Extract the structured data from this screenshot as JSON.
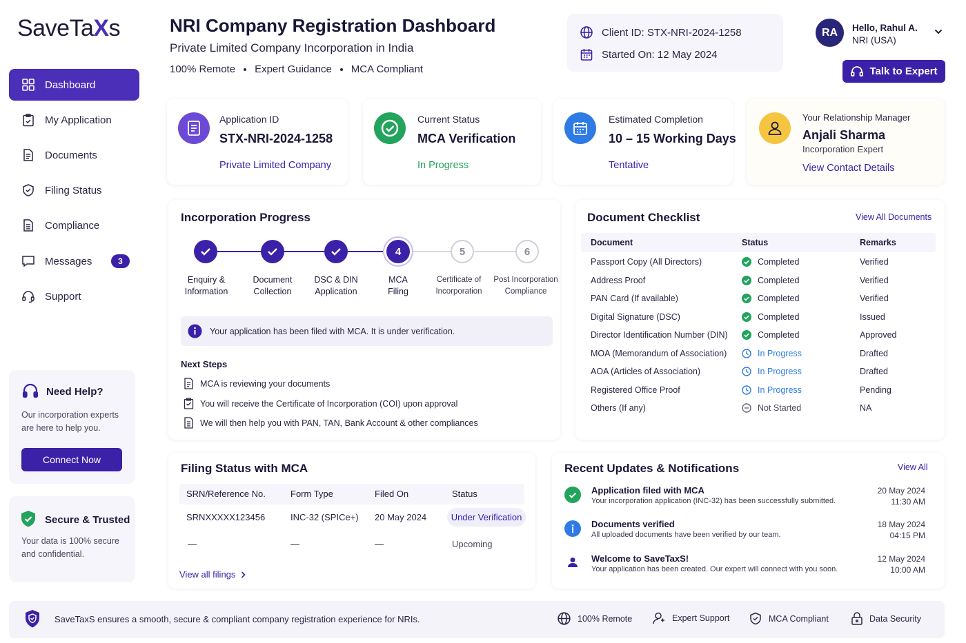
{
  "brand": {
    "logo_main": "SaveTa",
    "logo_x": "X",
    "logo_end": "s"
  },
  "sidebar": {
    "items": [
      {
        "label": "Dashboard"
      },
      {
        "label": "My Application"
      },
      {
        "label": "Documents"
      },
      {
        "label": "Filing Status"
      },
      {
        "label": "Compliance"
      },
      {
        "label": "Messages",
        "badge": "3"
      },
      {
        "label": "Support"
      }
    ],
    "help": {
      "title": "Need Help?",
      "text_line1": "Our incorporation experts",
      "text_line2": "are here to help you.",
      "button": "Connect Now"
    },
    "secure": {
      "title": "Secure & Trusted",
      "text_line1": "Your data is 100% secure",
      "text_line2": "and confidential."
    }
  },
  "header": {
    "title": "NRI Company Registration Dashboard",
    "subtitle": "Private Limited Company Incorporation in India",
    "tags": [
      "100% Remote",
      "Expert Guidance",
      "MCA Compliant"
    ],
    "client_id": "Client ID: STX-NRI-2024-1258",
    "started_on": "Started On: 12 May 2024",
    "avatar": "RA",
    "greeting": "Hello, Rahul A.",
    "user_location": "NRI (USA)",
    "talk_button": "Talk to Expert"
  },
  "stats": [
    {
      "label": "Application ID",
      "value": "STX-NRI-2024-1258",
      "sub": "Private Limited Company"
    },
    {
      "label": "Current Status",
      "value": "MCA Verification",
      "sub": "In Progress"
    },
    {
      "label": "Estimated Completion",
      "value": "10 – 15 Working Days",
      "sub": "Tentative"
    },
    {
      "label": "Your Relationship Manager",
      "value": "Anjali Sharma",
      "role": "Incorporation Expert",
      "sub": "View Contact Details"
    }
  ],
  "progress": {
    "title": "Incorporation Progress",
    "steps": [
      {
        "l1": "Enquiry &",
        "l2": "Information",
        "state": "done"
      },
      {
        "l1": "Document",
        "l2": "Collection",
        "state": "done"
      },
      {
        "l1": "DSC & DIN",
        "l2": "Application",
        "state": "done"
      },
      {
        "num": "4",
        "l1": "MCA",
        "l2": "Filing",
        "state": "current"
      },
      {
        "num": "5",
        "l1": "Certificate of",
        "l2": "Incorporation",
        "state": "todo"
      },
      {
        "num": "6",
        "l1": "Post Incorporation",
        "l2": "Compliance",
        "state": "todo"
      }
    ],
    "info": "Your application has been filed with MCA. It is under verification.",
    "next_title": "Next Steps",
    "next_steps": [
      "MCA is reviewing your documents",
      "You will receive the Certificate of Incorporation (COI) upon approval",
      "We will then help you with PAN, TAN, Bank Account & other compliances"
    ]
  },
  "checklist": {
    "title": "Document Checklist",
    "view_all": "View All Documents",
    "headers": [
      "Document",
      "Status",
      "Remarks"
    ],
    "rows": [
      {
        "doc": "Passport Copy (All Directors)",
        "status": "Completed",
        "remark": "Verified",
        "kind": "done"
      },
      {
        "doc": "Address Proof",
        "status": "Completed",
        "remark": "Verified",
        "kind": "done"
      },
      {
        "doc": "PAN Card (If available)",
        "status": "Completed",
        "remark": "Verified",
        "kind": "done"
      },
      {
        "doc": "Digital Signature (DSC)",
        "status": "Completed",
        "remark": "Issued",
        "kind": "done"
      },
      {
        "doc": "Director Identification Number (DIN)",
        "status": "Completed",
        "remark": "Approved",
        "kind": "done"
      },
      {
        "doc": "MOA (Memorandum of Association)",
        "status": "In Progress",
        "remark": "Drafted",
        "kind": "progress"
      },
      {
        "doc": "AOA (Articles of Association)",
        "status": "In Progress",
        "remark": "Drafted",
        "kind": "progress"
      },
      {
        "doc": "Registered Office Proof",
        "status": "In Progress",
        "remark": "Pending",
        "kind": "progress"
      },
      {
        "doc": "Others (If any)",
        "status": "Not Started",
        "remark": "NA",
        "kind": "none"
      }
    ]
  },
  "filing": {
    "title": "Filing Status with MCA",
    "headers": [
      "SRN/Reference No.",
      "Form Type",
      "Filed On",
      "Status"
    ],
    "rows": [
      [
        "SRNXXXXX123456",
        "INC-32 (SPICe+)",
        "20 May 2024",
        "Under Verification"
      ],
      [
        "—",
        "—",
        "—",
        "Upcoming"
      ]
    ],
    "view_all": "View all filings"
  },
  "updates": {
    "title": "Recent Updates & Notifications",
    "view_all": "View All",
    "items": [
      {
        "title": "Application filed with MCA",
        "text": "Your incorporation application (INC-32) has been successfully submitted.",
        "date": "20 May 2024",
        "time": "11:30 AM"
      },
      {
        "title": "Documents verified",
        "text": "All uploaded documents have been verified by our team.",
        "date": "18 May 2024",
        "time": "04:15 PM"
      },
      {
        "title": "Welcome to SaveTaxS!",
        "text": "Your application has been created. Our expert will connect with you soon.",
        "date": "12 May 2024",
        "time": "10:00 AM"
      }
    ]
  },
  "footer": {
    "text": "SaveTaxS ensures a smooth, secure & compliant company registration experience for NRIs.",
    "items": [
      "100% Remote",
      "Expert Support",
      "MCA Compliant",
      "Data Security"
    ]
  },
  "colors": {
    "primary": "#3b21a8",
    "success": "#22a45d",
    "info": "#2f7be5",
    "manager": "#f5c542"
  }
}
